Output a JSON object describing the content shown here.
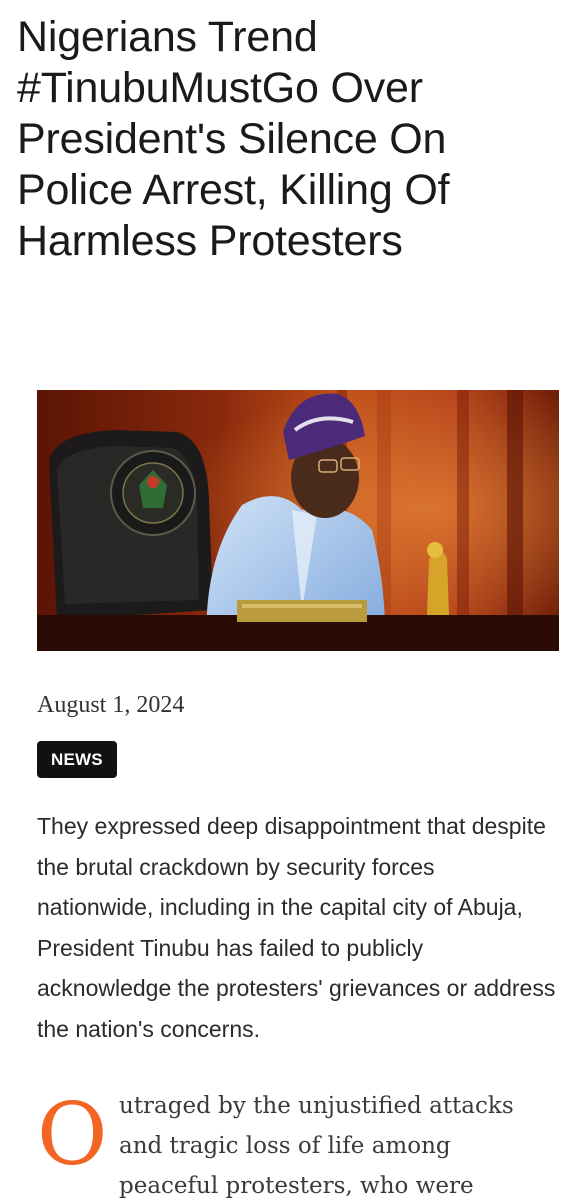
{
  "article": {
    "title": "Nigerians Trend #TinubuMustGo Over President's Silence On Police Arrest, Killing Of Harmless Protesters",
    "date": "August 1, 2024",
    "category": "NEWS",
    "summary": "They expressed deep disappointment that despite the brutal crackdown by security forces nationwide, including in the capital city of Abuja, President Tinubu has failed to publicly acknowledge the protesters' grievances or address the nation's concerns.",
    "body": {
      "dropcap": "O",
      "line1": "utraged by the unjustified attacks",
      "line2": "and tragic loss of life among",
      "line3": "peaceful protesters, who were"
    }
  },
  "colors": {
    "accent": "#f26522",
    "badge_bg": "#111111",
    "text": "#2b2b2b"
  },
  "image": {
    "description_icon": "photo-icon"
  }
}
